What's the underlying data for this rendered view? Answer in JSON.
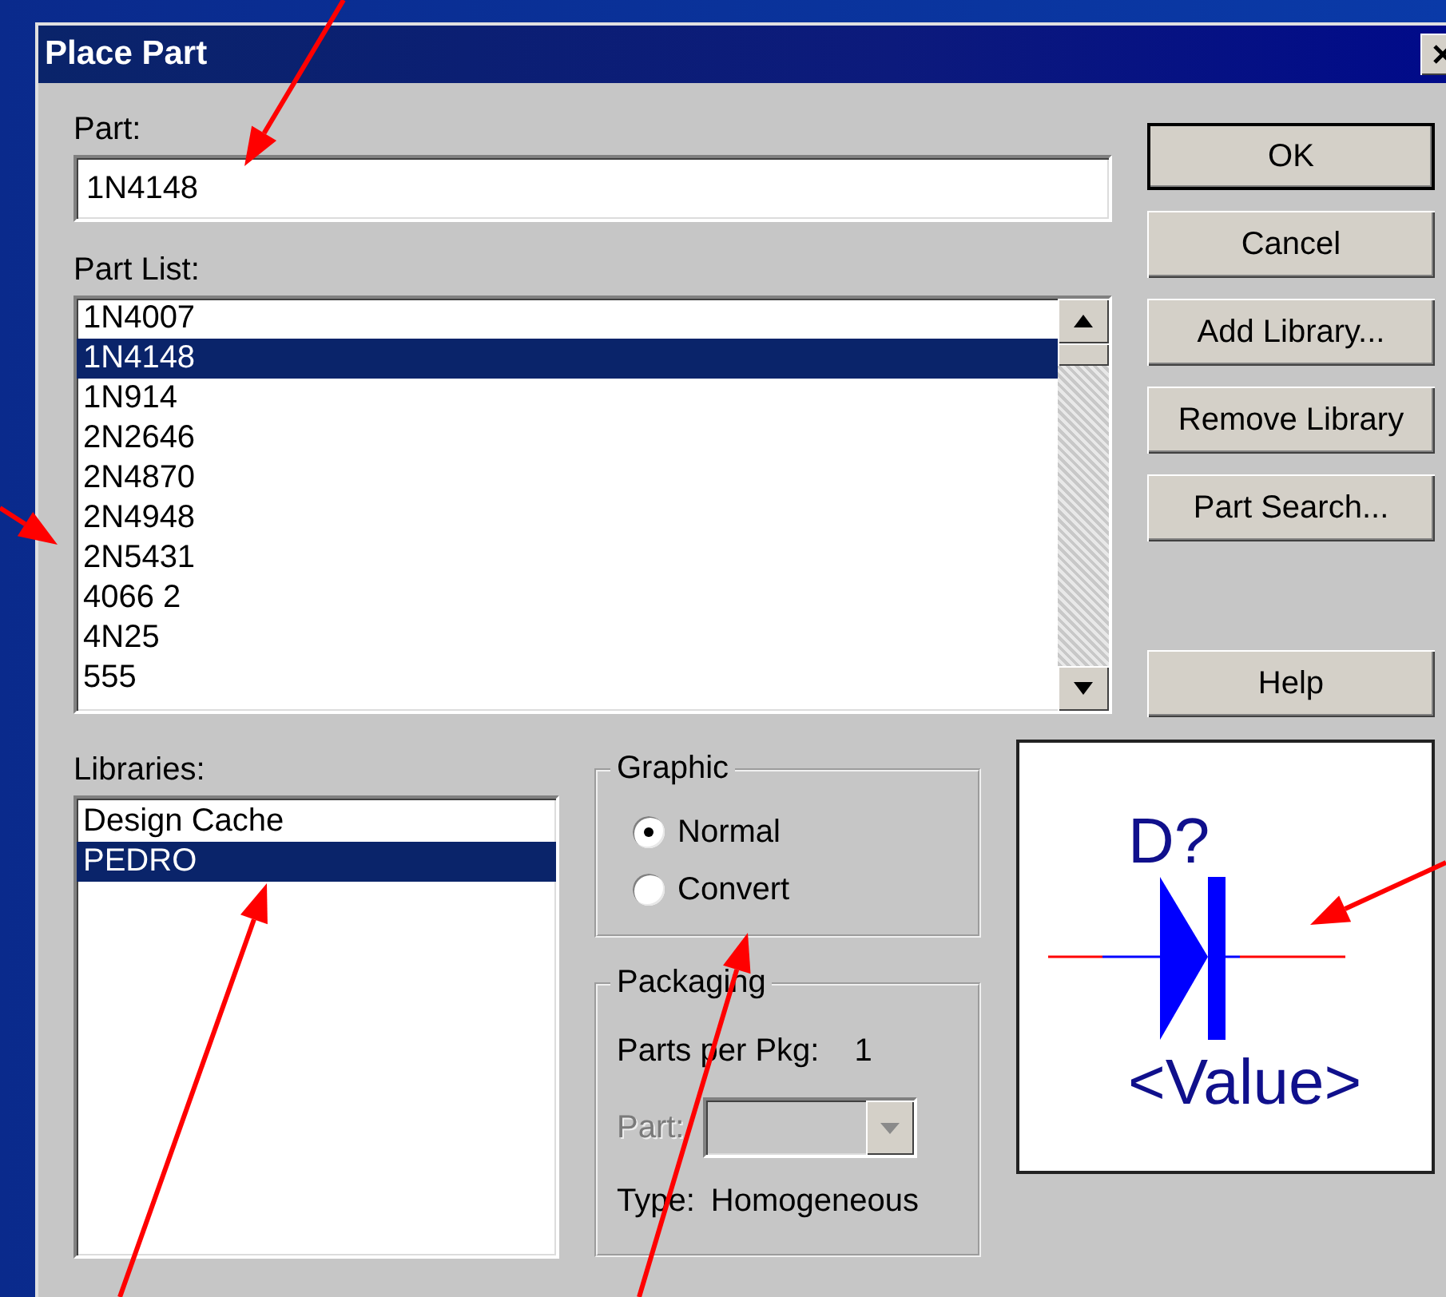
{
  "window": {
    "title": "Place Part"
  },
  "part": {
    "label": "Part:",
    "value": "1N4148"
  },
  "part_list": {
    "label": "Part List:",
    "items": [
      {
        "text": "1N4007",
        "selected": false
      },
      {
        "text": "1N4148",
        "selected": true
      },
      {
        "text": "1N914",
        "selected": false
      },
      {
        "text": "2N2646",
        "selected": false
      },
      {
        "text": "2N4870",
        "selected": false
      },
      {
        "text": "2N4948",
        "selected": false
      },
      {
        "text": "2N5431",
        "selected": false
      },
      {
        "text": "4066 2",
        "selected": false
      },
      {
        "text": "4N25",
        "selected": false
      },
      {
        "text": "555",
        "selected": false
      }
    ]
  },
  "buttons": [
    {
      "label": "OK",
      "default": true
    },
    {
      "label": "Cancel",
      "default": false
    },
    {
      "label": "Add Library...",
      "default": false
    },
    {
      "label": "Remove Library",
      "default": false
    },
    {
      "label": "Part Search...",
      "default": false
    },
    {
      "label": "Help",
      "default": false
    }
  ],
  "libraries": {
    "label": "Libraries:",
    "items": [
      {
        "text": "Design Cache",
        "selected": false
      },
      {
        "text": "PEDRO",
        "selected": true
      }
    ]
  },
  "graphic": {
    "title": "Graphic",
    "options": [
      {
        "label": "Normal",
        "selected": true
      },
      {
        "label": "Convert",
        "selected": false
      }
    ]
  },
  "packaging": {
    "title": "Packaging",
    "parts_per_pkg_label": "Parts per Pkg:",
    "parts_per_pkg": "1",
    "part_label": "Part:",
    "part_disabled": true,
    "type_label": "Type:",
    "type": "Homogeneous"
  },
  "preview": {
    "reference": "D?",
    "value": "<Value>"
  }
}
